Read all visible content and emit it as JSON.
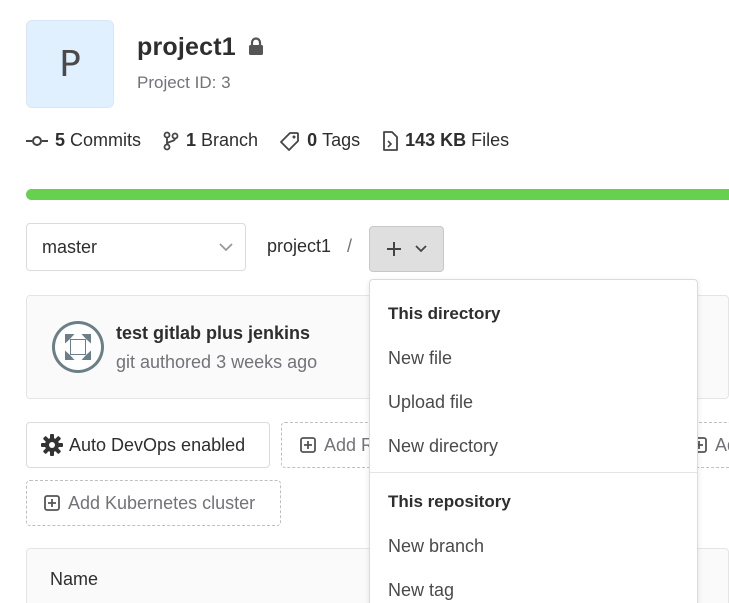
{
  "project": {
    "avatar_letter": "P",
    "name": "project1",
    "id_text": "Project ID: 3"
  },
  "stats": {
    "commits": {
      "count": "5",
      "label": "Commits"
    },
    "branches": {
      "count": "1",
      "label": "Branch"
    },
    "tags": {
      "count": "0",
      "label": "Tags"
    },
    "files": {
      "count": "143 KB",
      "label": "Files"
    }
  },
  "repo_size_bar": {
    "color": "#66d14e",
    "fill_fraction": 1.0
  },
  "branch_selector": {
    "value": "master"
  },
  "breadcrumb": {
    "root": "project1",
    "separator": "/"
  },
  "last_commit": {
    "title": "test gitlab plus jenkins",
    "meta": "git authored 3 weeks ago"
  },
  "actions": {
    "auto_devops": "Auto DevOps enabled",
    "add_readme": "Add README",
    "add_ci": "Add CI/CD configuration",
    "add_kubernetes": "Add Kubernetes cluster"
  },
  "file_table": {
    "columns": [
      "Name"
    ]
  },
  "new_dropdown": {
    "section_directory": "This directory",
    "new_file": "New file",
    "upload_file": "Upload file",
    "new_directory": "New directory",
    "section_repository": "This repository",
    "new_branch": "New branch",
    "new_tag": "New tag"
  },
  "icons": [
    "lock-icon",
    "commit-icon",
    "branch-icon",
    "tag-icon",
    "file-icon",
    "chevron-down-icon",
    "plus-icon",
    "settings-gear-icon",
    "plus-square-icon",
    "user-avatar-icon"
  ]
}
